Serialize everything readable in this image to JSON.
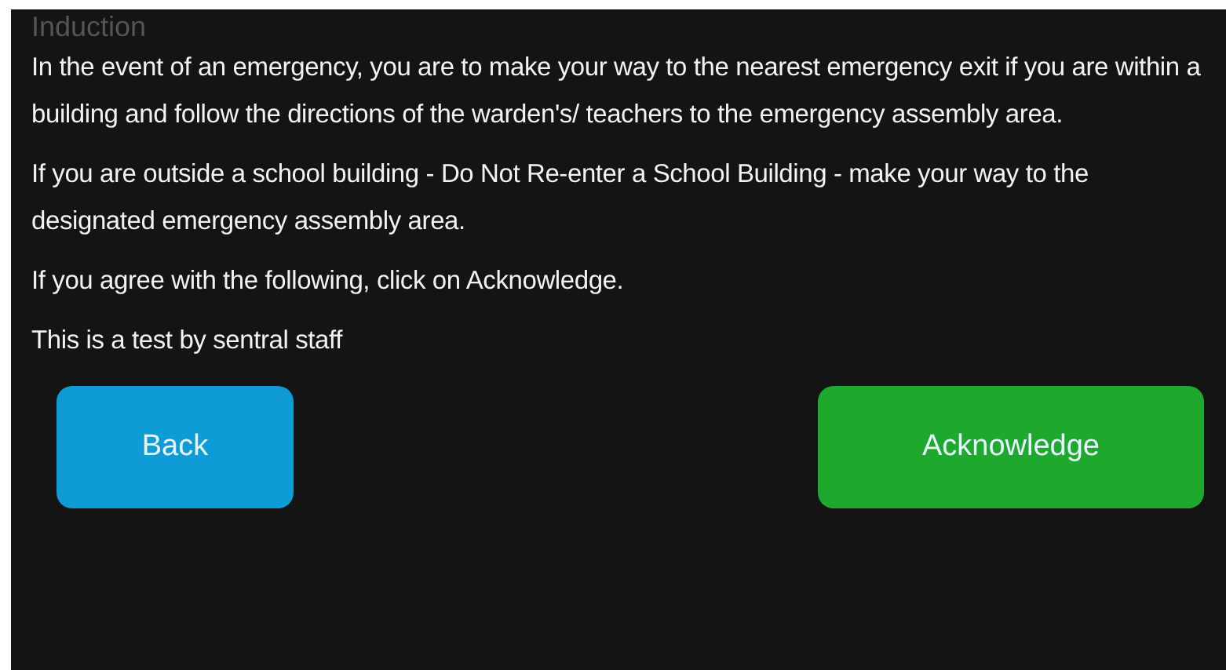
{
  "heading": "Induction",
  "paragraphs": [
    "In the event of an emergency, you are to make your way to the nearest emergency exit if you are within a building and follow the directions of the warden's/ teachers to the emergency assembly area.",
    "If you are outside a school building - Do Not Re-enter a School Building - make your way to the designated emergency assembly area.",
    "If you agree with the following, click on Acknowledge.",
    "This is a test by sentral staff"
  ],
  "buttons": [
    {
      "label": "Back",
      "kind": "secondary"
    },
    {
      "label": "Acknowledge",
      "kind": "primary"
    }
  ]
}
